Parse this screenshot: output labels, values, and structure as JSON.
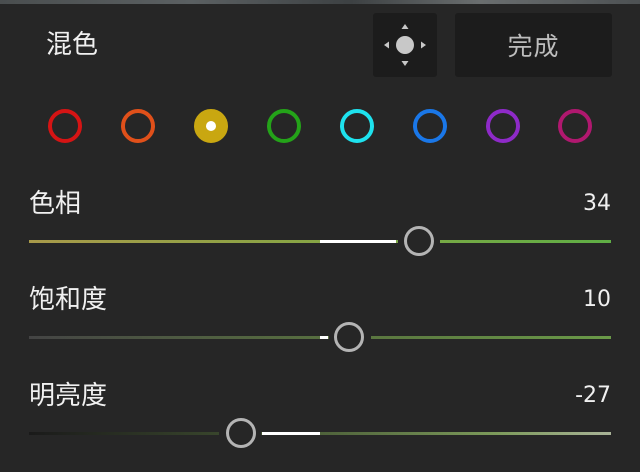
{
  "panel": {
    "title": "混色",
    "target_icon": "target-adjust-icon",
    "done_label": "完成"
  },
  "color_swatches": [
    {
      "name": "red",
      "color": "#d51414",
      "selected": false
    },
    {
      "name": "orange",
      "color": "#e0501a",
      "selected": false
    },
    {
      "name": "yellow",
      "color": "#c9a711",
      "selected": true
    },
    {
      "name": "green",
      "color": "#24a319",
      "selected": false
    },
    {
      "name": "aqua",
      "color": "#1ee2ee",
      "selected": false
    },
    {
      "name": "blue",
      "color": "#1a77e8",
      "selected": false
    },
    {
      "name": "purple",
      "color": "#8e2ac8",
      "selected": false
    },
    {
      "name": "magenta",
      "color": "#b0186f",
      "selected": false
    }
  ],
  "sliders": {
    "hue": {
      "label": "色相",
      "value": "34"
    },
    "saturation": {
      "label": "饱和度",
      "value": "10"
    },
    "luminance": {
      "label": "明亮度",
      "value": "-27"
    }
  },
  "colors": {
    "background": "#262626",
    "button_bg": "#1c1c1c",
    "text": "#f0f0f0",
    "muted_text": "#bdbdbd",
    "accent_white": "#ffffff"
  }
}
